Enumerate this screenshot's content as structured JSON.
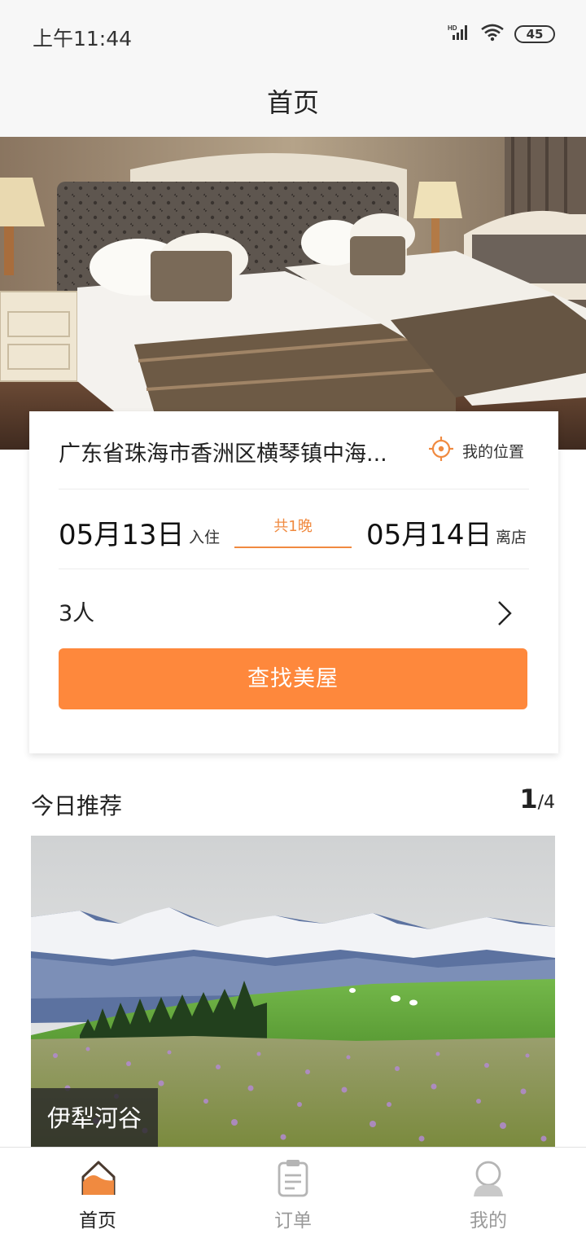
{
  "status_bar": {
    "time": "上午11:44",
    "network": "HD",
    "battery": "45"
  },
  "header": {
    "title": "首页"
  },
  "search": {
    "location": "广东省珠海市香洲区横琴镇中海...",
    "my_location_label": "我的位置",
    "checkin_date": "05月13日",
    "checkin_label": "入住",
    "nights": "共1晚",
    "checkout_date": "05月14日",
    "checkout_label": "离店",
    "guests": "3人",
    "button_label": "查找美屋"
  },
  "recommend": {
    "title": "今日推荐",
    "current": "1",
    "separator": "/",
    "total": "4",
    "place": "伊犁河谷"
  },
  "tabs": [
    {
      "label": "首页",
      "icon": "home-icon",
      "active": true
    },
    {
      "label": "订单",
      "icon": "order-clipboard-icon",
      "active": false
    },
    {
      "label": "我的",
      "icon": "profile-icon",
      "active": false
    }
  ],
  "colors": {
    "accent": "#fe883c",
    "accent_text": "#f08a40",
    "title_bar": "#f7f7f7"
  }
}
